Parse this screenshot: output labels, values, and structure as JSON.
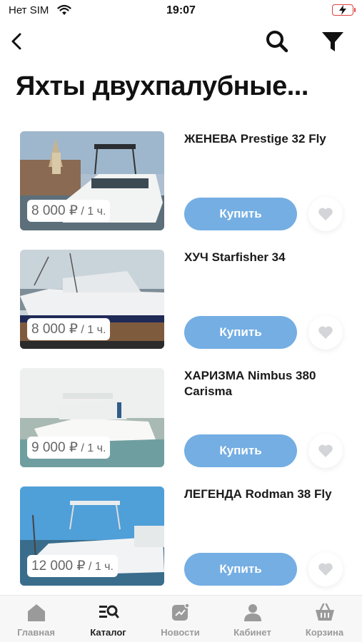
{
  "status_bar": {
    "carrier": "Нет SIM",
    "time": "19:07"
  },
  "nav": {
    "back_icon": "chevron-left-icon",
    "search_icon": "search-icon",
    "filter_icon": "filter-icon"
  },
  "page": {
    "title": "Яхты двухпалубные..."
  },
  "products": [
    {
      "name": "ЖЕНЕВА Prestige 32 Fly",
      "price": "8 000 ₽",
      "unit": " / 1 ч.",
      "buy_label": "Купить"
    },
    {
      "name": "ХУЧ Starfisher 34",
      "price": "8 000 ₽",
      "unit": " / 1 ч.",
      "buy_label": "Купить"
    },
    {
      "name": "ХАРИЗМА Nimbus 380 Carisma",
      "price": "9 000 ₽",
      "unit": " / 1 ч.",
      "buy_label": "Купить"
    },
    {
      "name": "ЛЕГЕНДА Rodman 38 Fly",
      "price": "12 000 ₽",
      "unit": " / 1 ч.",
      "buy_label": "Купить"
    }
  ],
  "tabs": [
    {
      "label": "Главная",
      "icon": "home-icon"
    },
    {
      "label": "Каталог",
      "icon": "catalog-icon"
    },
    {
      "label": "Новости",
      "icon": "news-icon"
    },
    {
      "label": "Кабинет",
      "icon": "profile-icon"
    },
    {
      "label": "Корзина",
      "icon": "cart-icon"
    }
  ],
  "colors": {
    "accent": "#74aee3",
    "text": "#1a1a1a",
    "muted": "#9a9a9a",
    "battery": "#e04040"
  }
}
